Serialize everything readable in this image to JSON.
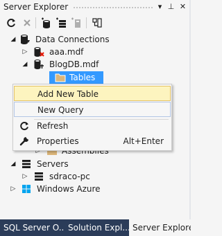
{
  "window": {
    "title": "Server Explorer",
    "pin_glyph": "⊥",
    "dropdown_glyph": "▾",
    "close_glyph": "✕"
  },
  "toolbar": {
    "icons": [
      "refresh-icon",
      "stop-icon",
      "connect-to-database-icon",
      "connect-to-server-icon",
      "connect-to-sharepoint-icon",
      "properties-icon"
    ]
  },
  "tree": {
    "data_connections": "Data Connections",
    "aaa_mdf": "aaa.mdf",
    "blogdb_mdf": "BlogDB.mdf",
    "tables": "Tables",
    "assemblies": "Assemblies",
    "servers": "Servers",
    "server_name": "sdraco-pc",
    "windows_azure": "Windows Azure"
  },
  "context_menu": {
    "add_new_table": "Add New Table",
    "new_query": "New Query",
    "refresh": "Refresh",
    "properties": "Properties",
    "properties_shortcut": "Alt+Enter"
  },
  "tabs": [
    {
      "label": "SQL Server O...",
      "active": false
    },
    {
      "label": "Solution Expl...",
      "active": false
    },
    {
      "label": "Server Explorer",
      "active": true
    }
  ],
  "colors": {
    "selection": "#3399ff",
    "tab_strip": "#2b3c59",
    "menu_highlight": "#fdf4bf"
  }
}
